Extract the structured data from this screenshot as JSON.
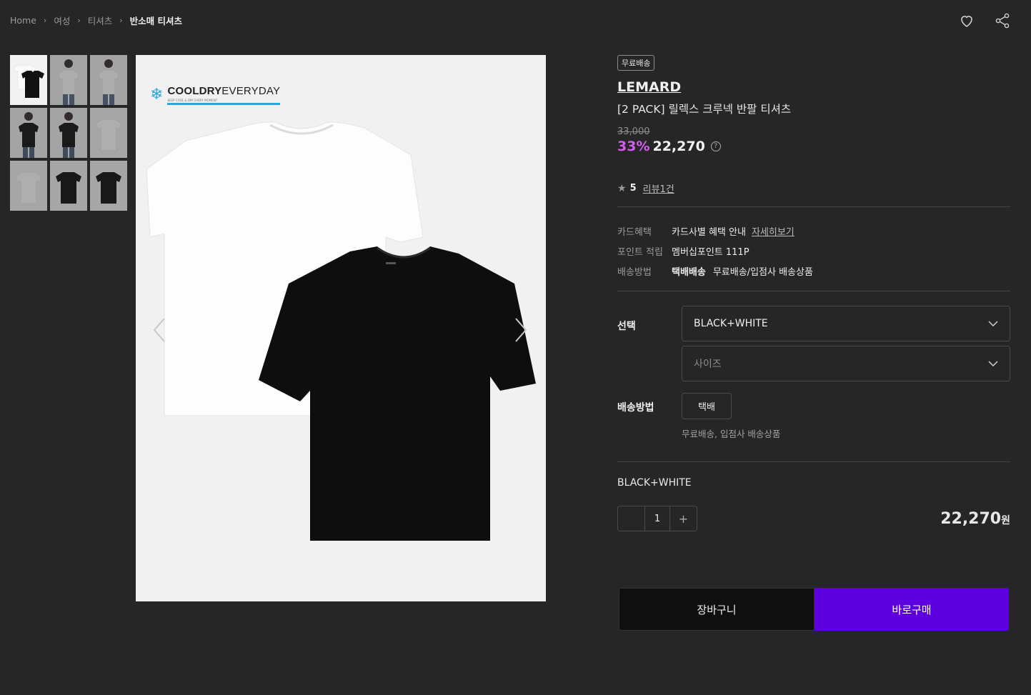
{
  "breadcrumb": {
    "items": [
      "Home",
      "여성",
      "티셔츠",
      "반소매 티셔츠"
    ]
  },
  "main_image": {
    "logo_bold": "COOLDRY",
    "logo_light": "EVERYDAY",
    "logo_tagline": "KEEP COOL & DRY EVERY MOMENT",
    "colors": {
      "logo_accent": "#29a8e0",
      "bg": "#f1f1f1"
    }
  },
  "product": {
    "badge": "무료배송",
    "brand": "LEMARD",
    "name": "[2 PACK] 릴렉스 크루넥 반팔 티셔츠",
    "original_price": "33,000",
    "discount": "33%",
    "price": "22,270",
    "rating": "5",
    "review_link": "리뷰1건"
  },
  "benefits": {
    "card_label": "카드혜택",
    "card_value": "카드사별 혜택 안내",
    "card_link": "자세히보기",
    "point_label": "포인트 적립",
    "point_value": "멤버십포인트 111P",
    "delivery_label": "배송방법",
    "delivery_bold": "택배배송",
    "delivery_value": "무료배송/입점사 배송상품"
  },
  "options": {
    "select_label": "선택",
    "color_value": "BLACK+WHITE",
    "size_placeholder": "사이즈",
    "ship_label": "배송방법",
    "ship_button": "택배",
    "ship_note": "무료배송, 입점사 배송상품"
  },
  "selected": {
    "name": "BLACK+WHITE",
    "qty": "1",
    "minus": "−",
    "plus": "+",
    "total": "22,270",
    "currency": "원"
  },
  "actions": {
    "cart": "장바구니",
    "buy": "바로구매"
  },
  "colors": {
    "page_bg": "#262626",
    "discount": "#d65bf2",
    "buy_button": "#5d00e0",
    "cart_button": "#0f0f0f"
  }
}
